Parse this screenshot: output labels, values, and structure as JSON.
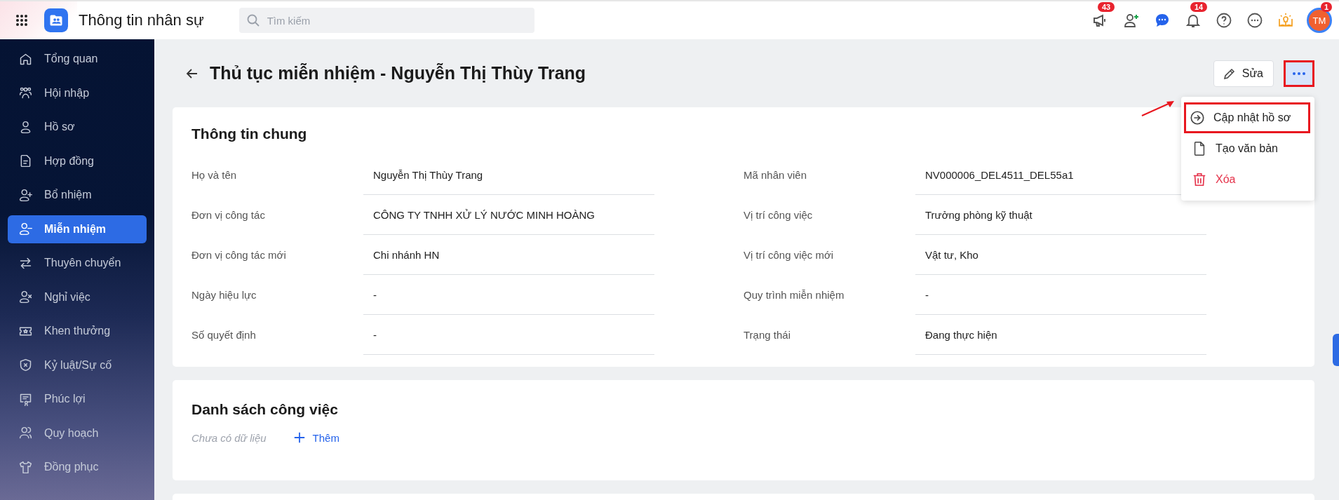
{
  "app": {
    "title": "Thông tin nhân sự",
    "search": {
      "placeholder": "Tìm kiếm"
    }
  },
  "header_icons": [
    {
      "kind": "announce",
      "badge": "43"
    },
    {
      "kind": "add-user"
    },
    {
      "kind": "chat"
    },
    {
      "kind": "bell",
      "badge": "14"
    },
    {
      "kind": "help"
    },
    {
      "kind": "more"
    },
    {
      "kind": "idea"
    }
  ],
  "avatar": {
    "initials": "TM",
    "badge": "1"
  },
  "sidebar": {
    "items": [
      {
        "kind": "home",
        "label": "Tổng quan",
        "selected": false
      },
      {
        "kind": "group",
        "label": "Hội nhập",
        "selected": false
      },
      {
        "kind": "user",
        "label": "Hồ sơ",
        "selected": false
      },
      {
        "kind": "doc",
        "label": "Hợp đồng",
        "selected": false
      },
      {
        "kind": "user-plus",
        "label": "Bổ nhiệm",
        "selected": false
      },
      {
        "kind": "user-minus",
        "label": "Miễn nhiệm",
        "selected": true
      },
      {
        "kind": "swap",
        "label": "Thuyên chuyển",
        "selected": false
      },
      {
        "kind": "user-x",
        "label": "Nghỉ việc",
        "selected": false
      },
      {
        "kind": "ticket",
        "label": "Khen thưởng",
        "selected": false
      },
      {
        "kind": "shield",
        "label": "Kỷ luật/Sự cố",
        "selected": false
      },
      {
        "kind": "cert",
        "label": "Phúc lợi",
        "selected": false
      },
      {
        "kind": "users",
        "label": "Quy hoạch",
        "selected": false
      },
      {
        "kind": "shirt",
        "label": "Đồng phục",
        "selected": false
      }
    ]
  },
  "page": {
    "title": "Thủ tục miễn nhiệm - Nguyễn Thị Thùy Trang",
    "edit_button": "Sửa",
    "more_button": {
      "highlighted": true
    },
    "menu": [
      {
        "kind": "update",
        "label": "Cập nhật hồ sơ",
        "highlighted": true
      },
      {
        "kind": "create",
        "label": "Tạo văn bản",
        "highlighted": false
      },
      {
        "kind": "delete",
        "label": "Xóa",
        "highlighted": false
      }
    ]
  },
  "general": {
    "title": "Thông tin chung",
    "fields": [
      {
        "label": "Họ và tên",
        "value": "Nguyễn Thị Thùy Trang"
      },
      {
        "label": "Mã nhân viên",
        "value": "NV000006_DEL4511_DEL55a1"
      },
      {
        "label": "Đơn vị công tác",
        "value": "CÔNG TY TNHH XỬ LÝ NƯỚC MINH HOÀNG"
      },
      {
        "label": "Vị trí công việc",
        "value": "Trưởng phòng kỹ thuật"
      },
      {
        "label": "Đơn vị công tác mới",
        "value": "Chi nhánh HN"
      },
      {
        "label": "Vị trí công việc mới",
        "value": "Vật tư, Kho"
      },
      {
        "label": "Ngày hiệu lực",
        "value": "-"
      },
      {
        "label": "Quy trình miễn nhiệm",
        "value": "-"
      },
      {
        "label": "Số quyết định",
        "value": "-"
      },
      {
        "label": "Trạng thái",
        "value": "Đang thực hiện"
      }
    ]
  },
  "tasks": {
    "title": "Danh sách công việc",
    "empty": "Chưa có dữ liệu",
    "add": "Thêm"
  }
}
